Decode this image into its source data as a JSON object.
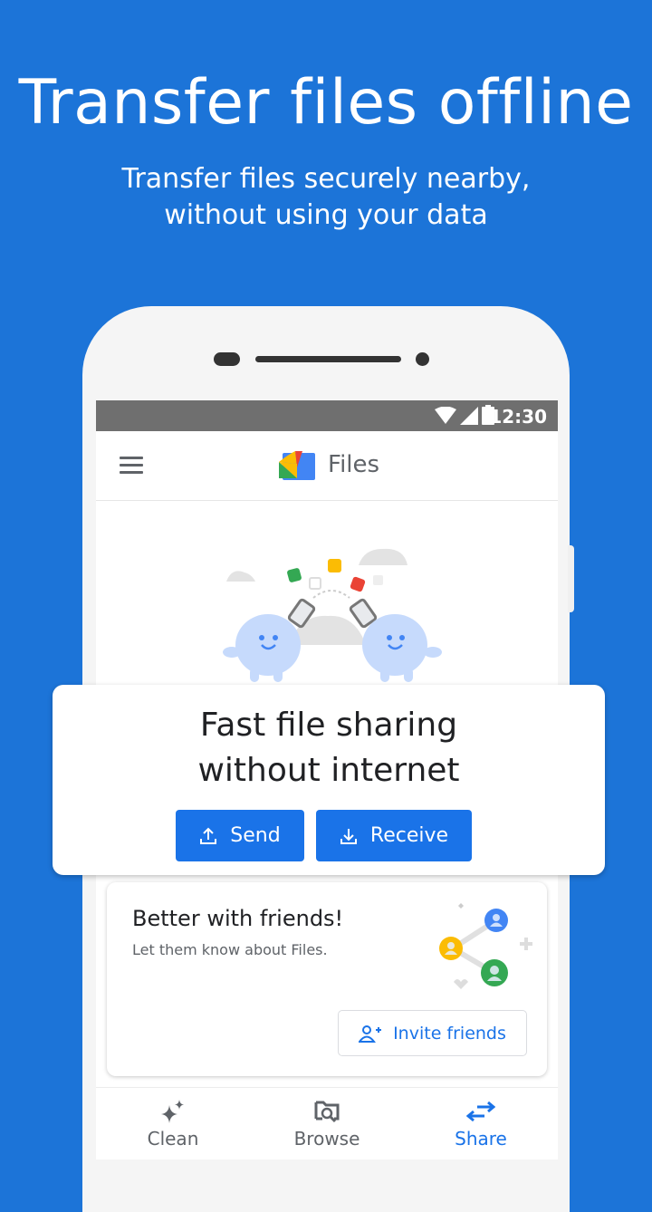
{
  "hero": {
    "title": "Transfer files offline",
    "subtitle_line1": "Transfer files securely nearby,",
    "subtitle_line2": "without using your data"
  },
  "status_bar": {
    "time": "12:30",
    "icons": [
      "wifi-icon",
      "signal-icon",
      "battery-icon"
    ]
  },
  "app_bar": {
    "menu_icon": "hamburger-menu-icon",
    "logo": "files-logo-icon",
    "title": "Files"
  },
  "share_card": {
    "title_line1": "Fast file sharing",
    "title_line2": "without internet",
    "send_label": "Send",
    "receive_label": "Receive"
  },
  "friends_card": {
    "title": "Better with friends!",
    "subtitle": "Let them know about Files.",
    "invite_label": "Invite friends"
  },
  "bottom_nav": {
    "items": [
      {
        "label": "Clean",
        "icon": "sparkle-icon",
        "active": false
      },
      {
        "label": "Browse",
        "icon": "folder-search-icon",
        "active": false
      },
      {
        "label": "Share",
        "icon": "swap-arrows-icon",
        "active": true
      }
    ]
  },
  "colors": {
    "background": "#1c74d8",
    "accent": "#1a73e8",
    "status_bar": "#6f6f6f"
  }
}
